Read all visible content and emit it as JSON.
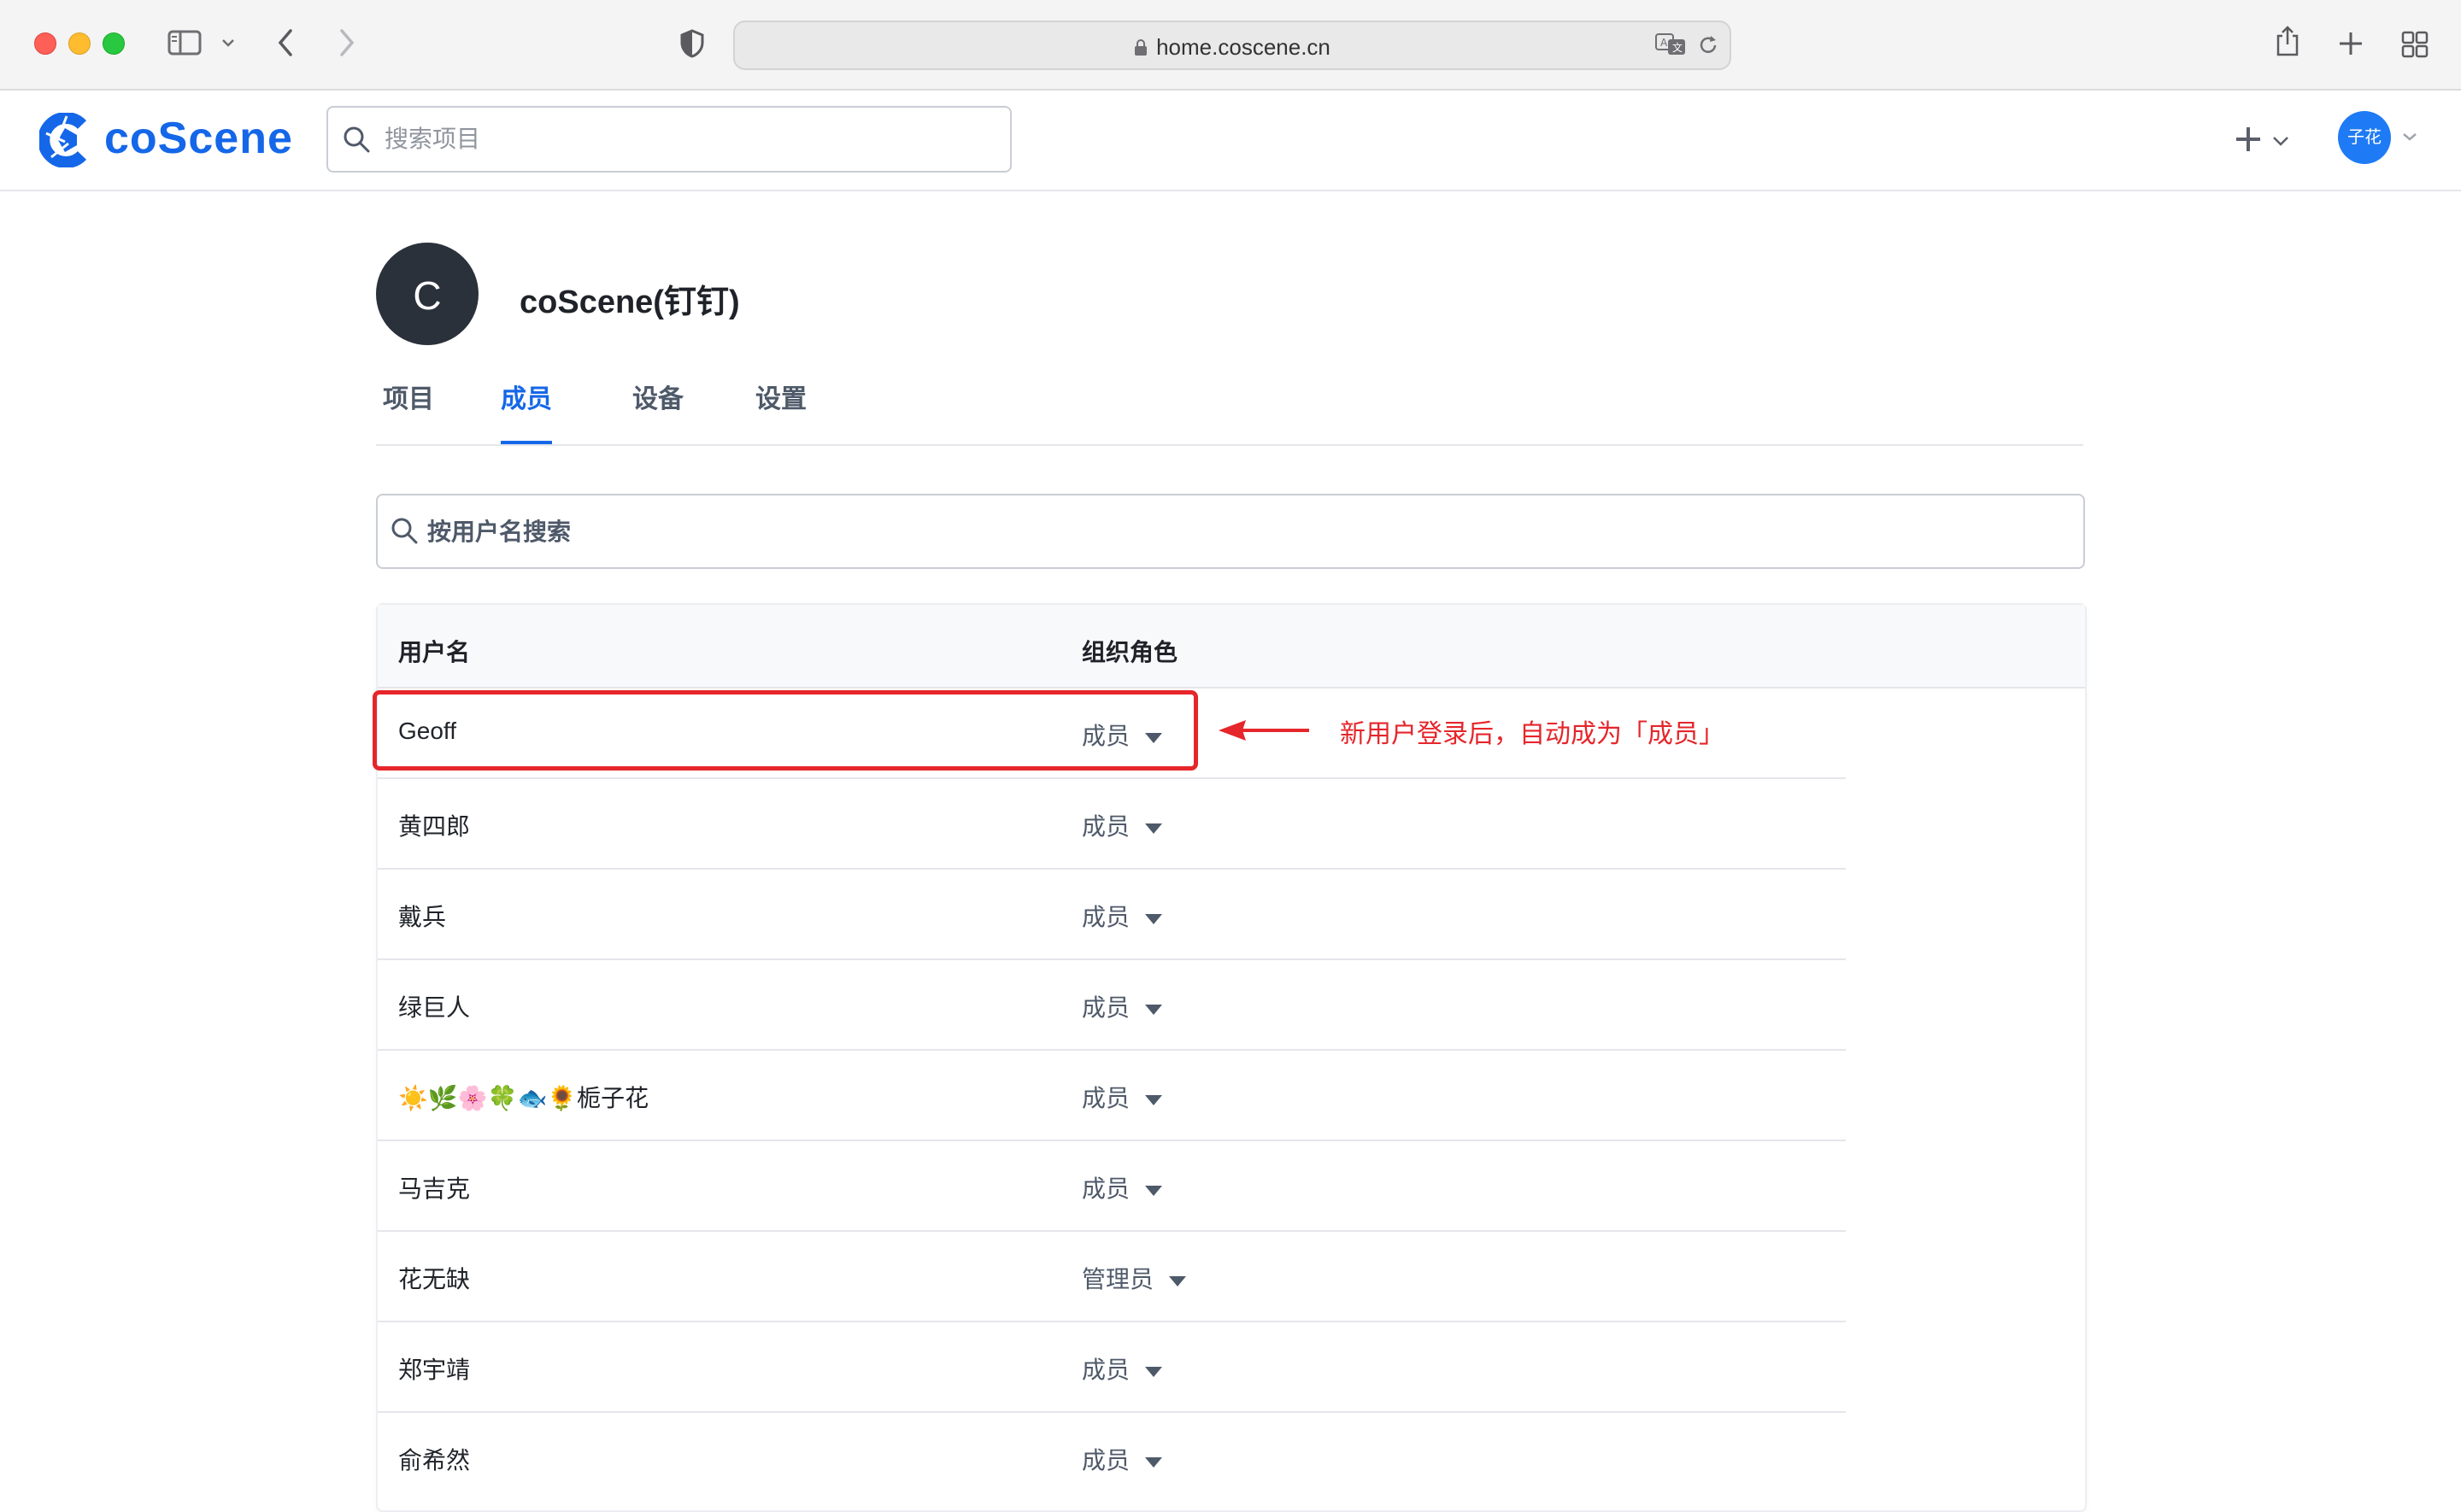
{
  "browser": {
    "url": "home.coscene.cn"
  },
  "header": {
    "logo_text": "coScene",
    "search_placeholder": "搜索项目",
    "user_avatar_text": "子花"
  },
  "org": {
    "avatar_letter": "C",
    "name": "coScene(钉钉)"
  },
  "tabs": [
    {
      "label": "项目",
      "active": false
    },
    {
      "label": "成员",
      "active": true
    },
    {
      "label": "设备",
      "active": false
    },
    {
      "label": "设置",
      "active": false
    }
  ],
  "member_search": {
    "placeholder": "按用户名搜索"
  },
  "table": {
    "columns": [
      "用户名",
      "组织角色"
    ],
    "rows": [
      {
        "name": "Geoff",
        "role": "成员"
      },
      {
        "name": "黄四郎",
        "role": "成员"
      },
      {
        "name": "戴兵",
        "role": "成员"
      },
      {
        "name": "绿巨人",
        "role": "成员"
      },
      {
        "name": "☀️🌿🌸🍀🐟🌻栀子花",
        "role": "成员"
      },
      {
        "name": "马吉克",
        "role": "成员"
      },
      {
        "name": "花无缺",
        "role": "管理员"
      },
      {
        "name": "郑宇靖",
        "role": "成员"
      },
      {
        "name": "俞希然",
        "role": "成员"
      }
    ]
  },
  "annotation": {
    "text": "新用户登录后，自动成为「成员」",
    "color": "#e5262b"
  },
  "colors": {
    "brand": "#1467e8",
    "avatar": "#1f7bf5",
    "org_avatar": "#2b313a"
  }
}
